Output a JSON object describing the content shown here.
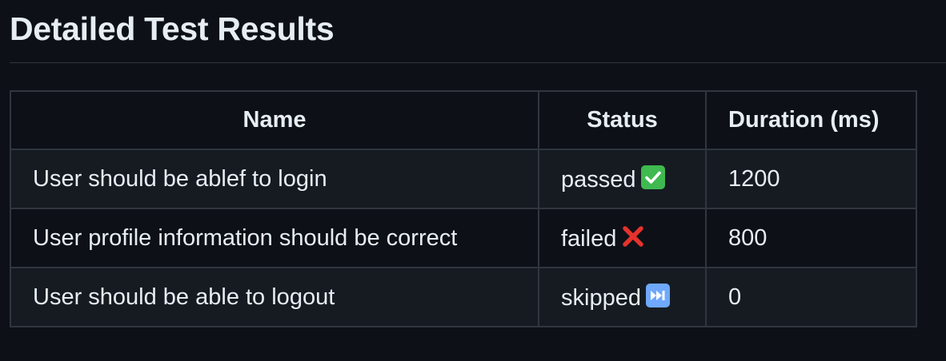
{
  "heading": "Detailed Test Results",
  "table": {
    "headers": [
      "Name",
      "Status",
      "Duration (ms)"
    ],
    "rows": [
      {
        "name": "User should be ablef to login",
        "status": "passed",
        "status_icon": "check-mark-icon",
        "duration": "1200"
      },
      {
        "name": "User profile information should be correct",
        "status": "failed",
        "status_icon": "cross-mark-icon",
        "duration": "800"
      },
      {
        "name": "User should be able to logout",
        "status": "skipped",
        "status_icon": "fast-forward-icon",
        "duration": "0"
      }
    ]
  },
  "colors": {
    "background": "#0d1117",
    "row_alt": "#161b22",
    "border": "#30363d",
    "text": "#e6edf3",
    "passed": "#3fb950",
    "failed": "#e5322d",
    "skipped": "#6ea8ff"
  }
}
